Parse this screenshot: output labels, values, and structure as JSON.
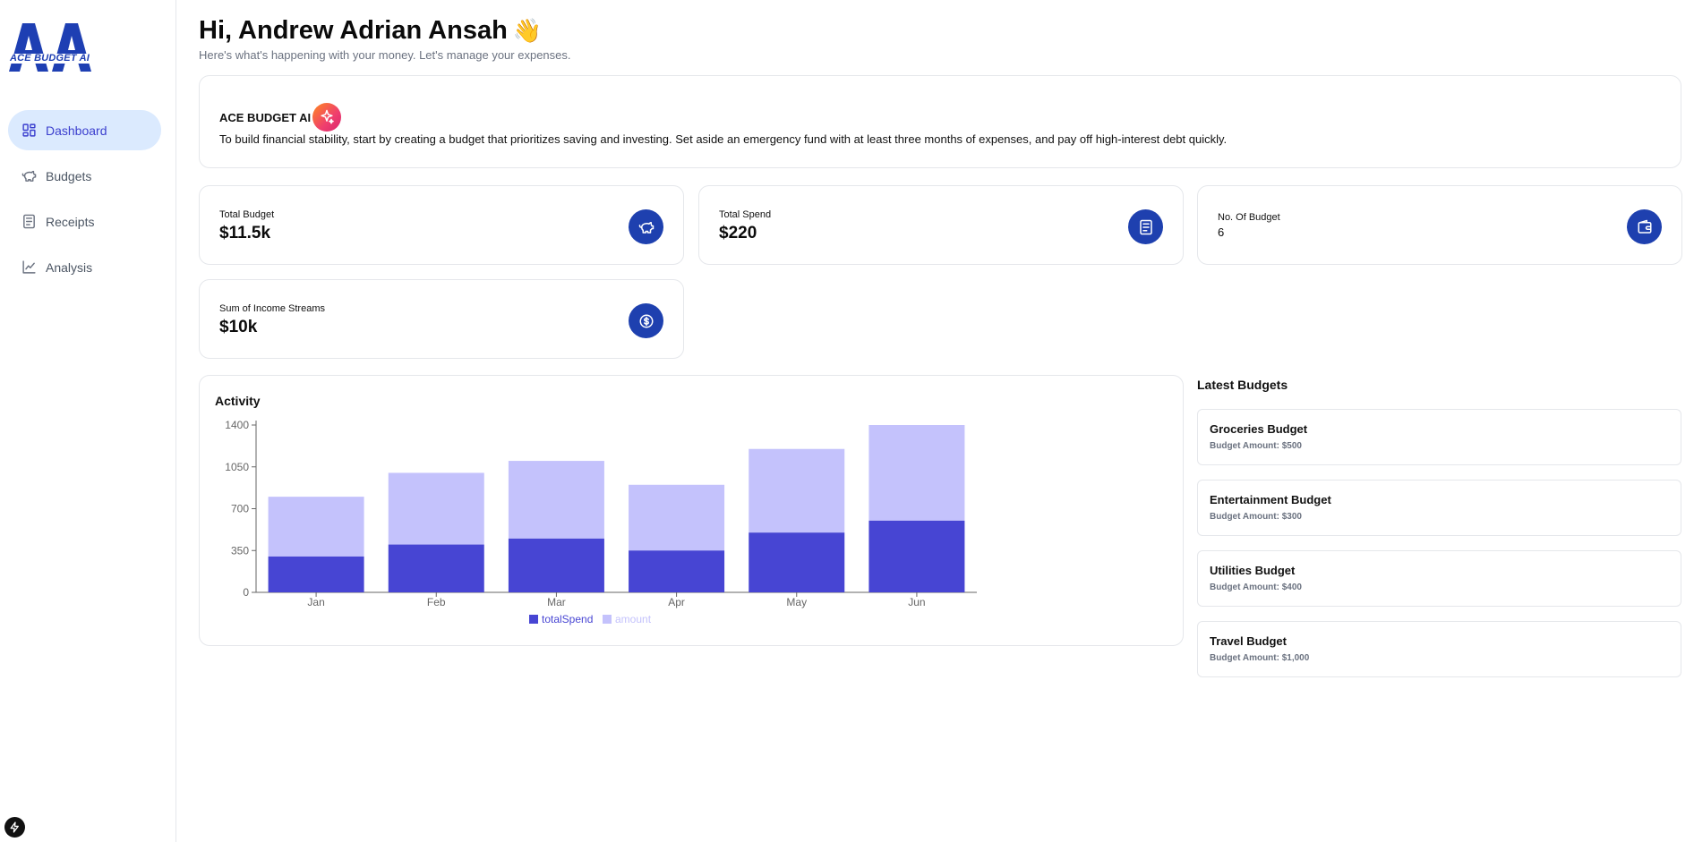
{
  "brand": {
    "logo_text": "ACE BUDGET AI",
    "primary_color": "#1e40af",
    "accent_color": "#4745d3"
  },
  "sidebar": {
    "items": [
      {
        "label": "Dashboard",
        "icon": "dashboard-grid-icon",
        "active": true
      },
      {
        "label": "Budgets",
        "icon": "piggy-bank-icon",
        "active": false
      },
      {
        "label": "Receipts",
        "icon": "receipt-icon",
        "active": false
      },
      {
        "label": "Analysis",
        "icon": "line-chart-icon",
        "active": false
      }
    ]
  },
  "header": {
    "greeting": "Hi, Andrew Adrian Ansah",
    "wave": "👋",
    "subtitle": "Here's what's happening with your money. Let's manage your expenses."
  },
  "ai_card": {
    "title": "ACE BUDGET AI",
    "message": "To build financial stability, start by creating a budget that prioritizes saving and investing. Set aside an emergency fund with at least three months of expenses, and pay off high-interest debt quickly."
  },
  "stats": {
    "total_budget": {
      "label": "Total Budget",
      "value": "$11.5k",
      "icon": "piggy-bank-icon"
    },
    "total_spend": {
      "label": "Total Spend",
      "value": "$220",
      "icon": "receipt-icon"
    },
    "no_of_budget": {
      "label": "No. Of Budget",
      "value": "6",
      "icon": "wallet-icon"
    },
    "income": {
      "label": "Sum of Income Streams",
      "value": "$10k",
      "icon": "dollar-circle-icon"
    }
  },
  "activity": {
    "title": "Activity"
  },
  "chart_data": {
    "type": "bar",
    "stacked": true,
    "categories": [
      "Jan",
      "Feb",
      "Mar",
      "Apr",
      "May",
      "Jun"
    ],
    "series": [
      {
        "name": "totalSpend",
        "values": [
          300,
          400,
          450,
          350,
          500,
          600
        ],
        "color": "#4745d3"
      },
      {
        "name": "amount",
        "values": [
          500,
          600,
          650,
          550,
          700,
          800
        ],
        "color": "#c4c2fc"
      }
    ],
    "yticks": [
      0,
      350,
      700,
      1050,
      1400
    ],
    "ylim": [
      0,
      1400
    ],
    "legend": "bottom-center"
  },
  "latest_budgets": {
    "title": "Latest Budgets",
    "items": [
      {
        "name": "Groceries Budget",
        "amount": "Budget Amount: $500"
      },
      {
        "name": "Entertainment Budget",
        "amount": "Budget Amount: $300"
      },
      {
        "name": "Utilities Budget",
        "amount": "Budget Amount: $400"
      },
      {
        "name": "Travel Budget",
        "amount": "Budget Amount: $1,000"
      }
    ]
  }
}
